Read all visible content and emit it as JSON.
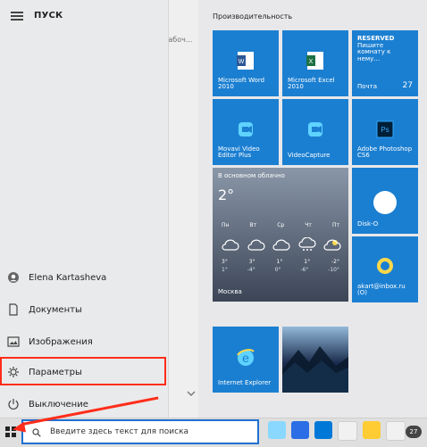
{
  "menu": {
    "title": "ПУСК",
    "recent_peek": "у рабоч..."
  },
  "rail": {
    "items": [
      {
        "label": "Elena Kartasheva",
        "icon": "user-icon"
      },
      {
        "label": "Документы",
        "icon": "document-icon"
      },
      {
        "label": "Изображения",
        "icon": "image-icon"
      },
      {
        "label": "Параметры",
        "icon": "gear-icon"
      },
      {
        "label": "Выключение",
        "icon": "power-icon"
      }
    ]
  },
  "tiles_group": {
    "title": "Производительность",
    "tiles": [
      {
        "key": "word",
        "label": "Microsoft Word 2010"
      },
      {
        "key": "excel",
        "label": "Microsoft Excel 2010"
      },
      {
        "key": "mail",
        "top1": "RESERVED",
        "top2": "Пишите комнату к нему…",
        "label": "Почта",
        "badge": "27"
      },
      {
        "key": "movavi",
        "label": "Movavi Video Editor Plus"
      },
      {
        "key": "videocapture",
        "label": "VideoCapture"
      },
      {
        "key": "photoshop",
        "label": "Adobe Photoshop CS6"
      },
      {
        "key": "disko",
        "label": "Disk-O"
      },
      {
        "key": "email",
        "label": "akart@inbox.ru (O)"
      },
      {
        "key": "ie",
        "label": "Internet Explorer"
      }
    ]
  },
  "weather": {
    "top": "В основном облачно",
    "temp": "2°",
    "days": [
      "Пн",
      "Вт",
      "Ср",
      "Чт",
      "Пт"
    ],
    "highs": [
      "3°",
      "3°",
      "1°",
      "1°",
      "-2°"
    ],
    "lows": [
      "1°",
      "-4°",
      "0°",
      "-6°",
      "-10°"
    ],
    "city": "Москва"
  },
  "taskbar": {
    "search_placeholder": "Введите здесь текст для поиска",
    "badge": "27"
  },
  "colors": {
    "tile_blue": "#1b7fd1",
    "highlight": "#ff2d1a"
  }
}
